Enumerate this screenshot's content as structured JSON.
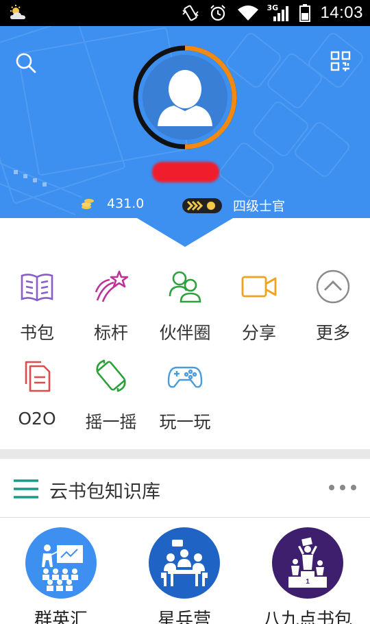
{
  "status_bar": {
    "time": "14:03",
    "network": "3G",
    "icons": [
      "weather-icon",
      "vibrate-icon",
      "alarm-icon",
      "wifi-icon",
      "signal-icon",
      "battery-icon"
    ]
  },
  "profile": {
    "coins": "431.0",
    "rank": "四级士官",
    "avatar_progress": 0.5
  },
  "menu": [
    {
      "label": "书包",
      "icon": "book-icon",
      "color": "#8a5cc9"
    },
    {
      "label": "标杆",
      "icon": "shooting-star-icon",
      "color": "#c0309a"
    },
    {
      "label": "伙伴圈",
      "icon": "partners-icon",
      "color": "#2aa13a"
    },
    {
      "label": "分享",
      "icon": "video-camera-icon",
      "color": "#f0a21e"
    },
    {
      "label": "更多",
      "icon": "chevron-up-circle-icon",
      "color": "#8a8a8a"
    },
    {
      "label": "O2O",
      "icon": "document-copy-icon",
      "color": "#e04a4a"
    },
    {
      "label": "摇一摇",
      "icon": "shake-phone-icon",
      "color": "#2aa13a"
    },
    {
      "label": "玩一玩",
      "icon": "gamepad-icon",
      "color": "#4a9ae0"
    }
  ],
  "section": {
    "title": "云书包知识库",
    "accent": "#1a9a86"
  },
  "bottom": [
    {
      "label": "群英汇",
      "color": "#3d8ff0"
    },
    {
      "label": "星兵营",
      "color": "#1f63c4"
    },
    {
      "label": "八九点书包",
      "color": "#3d1f6e"
    }
  ],
  "colors": {
    "header_bg": "#3d8ff0",
    "ring_track": "#111111",
    "ring_progress": "#f08a14"
  }
}
